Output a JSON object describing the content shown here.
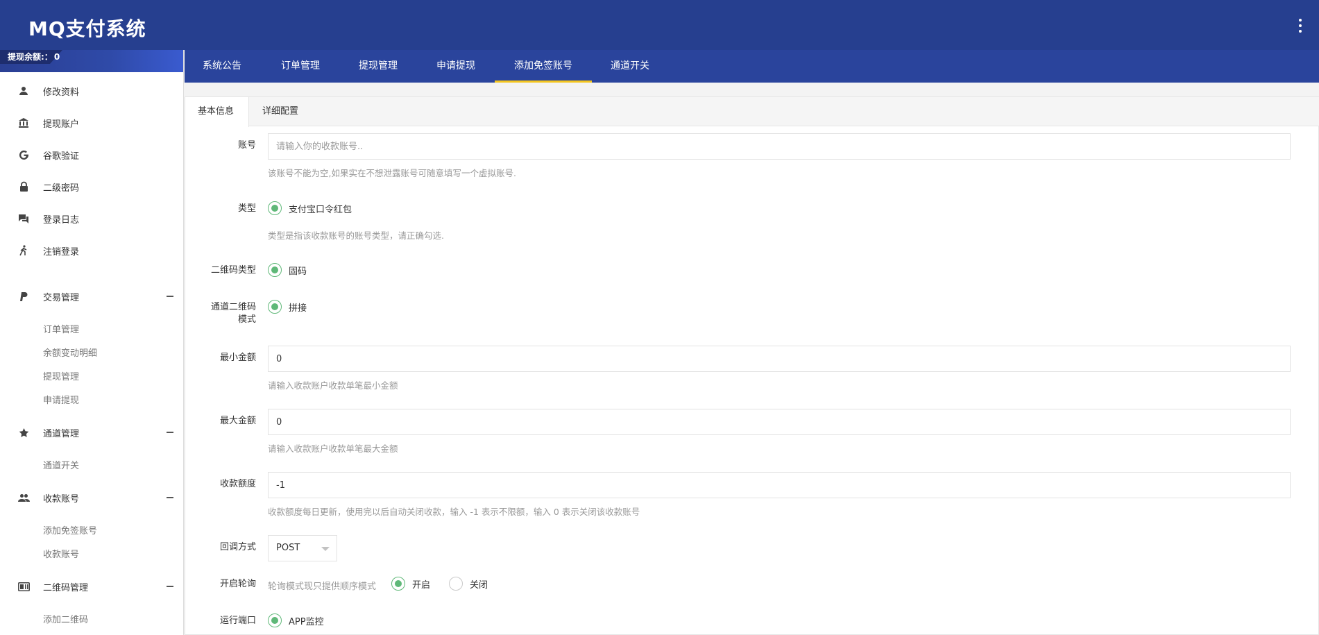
{
  "app": {
    "title": "MQ支付系统"
  },
  "balance": {
    "label": "提现余额:：",
    "value": "0"
  },
  "sidebar": {
    "items": [
      {
        "label": "修改资料",
        "icon": "person-icon"
      },
      {
        "label": "提现账户",
        "icon": "bank-icon"
      },
      {
        "label": "谷歌验证",
        "icon": "google-icon"
      },
      {
        "label": "二级密码",
        "icon": "lock-icon"
      },
      {
        "label": "登录日志",
        "icon": "forum-icon"
      },
      {
        "label": "注销登录",
        "icon": "walk-icon"
      }
    ],
    "groups": [
      {
        "label": "交易管理",
        "icon": "paypal-icon",
        "subs": [
          "订单管理",
          "余额变动明细",
          "提现管理",
          "申请提现"
        ]
      },
      {
        "label": "通道管理",
        "icon": "star-icon",
        "subs": [
          "通道开关"
        ]
      },
      {
        "label": "收款账号",
        "icon": "people-icon",
        "subs": [
          "添加免签账号",
          "收款账号"
        ]
      },
      {
        "label": "二维码管理",
        "icon": "qr-card-icon",
        "subs": [
          "添加二维码"
        ]
      }
    ]
  },
  "subnav": {
    "tabs": [
      "系统公告",
      "订单管理",
      "提现管理",
      "申请提现",
      "添加免签账号",
      "通道开关"
    ],
    "active": "添加免签账号"
  },
  "inner_tabs": [
    "基本信息",
    "详细配置"
  ],
  "form": {
    "account": {
      "label": "账号",
      "placeholder": "请输入你的收款账号..",
      "hint": "该账号不能为空,如果实在不想泄露账号可随意填写一个虚拟账号."
    },
    "type": {
      "label": "类型",
      "option": "支付宝口令红包",
      "hint": "类型是指该收款账号的账号类型，请正确勾选."
    },
    "qr_type": {
      "label": "二维码类型",
      "option": "固码"
    },
    "channel_qr": {
      "label_line1": "通道二维码",
      "label_line2": "模式",
      "option": "拼接"
    },
    "min_amount": {
      "label": "最小金额",
      "value": "0",
      "hint": "请输入收款账户收款单笔最小金额"
    },
    "max_amount": {
      "label": "最大金额",
      "value": "0",
      "hint": "请输入收款账户收款单笔最大金额"
    },
    "quota": {
      "label": "收款额度",
      "value": "-1",
      "hint": "收款额度每日更新，使用完以后自动关闭收款，输入 -1 表示不限额，输入 0 表示关闭该收款账号"
    },
    "callback": {
      "label": "回调方式",
      "value": "POST"
    },
    "polling": {
      "label": "开启轮询",
      "note": "轮询模式现只提供顺序模式",
      "on": "开启",
      "off": "关闭"
    },
    "port": {
      "label": "运行端口",
      "option": "APP监控"
    }
  },
  "colors": {
    "header": "#263f8f",
    "subnav": "#2a449c",
    "accent": "#f3c51e",
    "radio": "#5fb878"
  }
}
